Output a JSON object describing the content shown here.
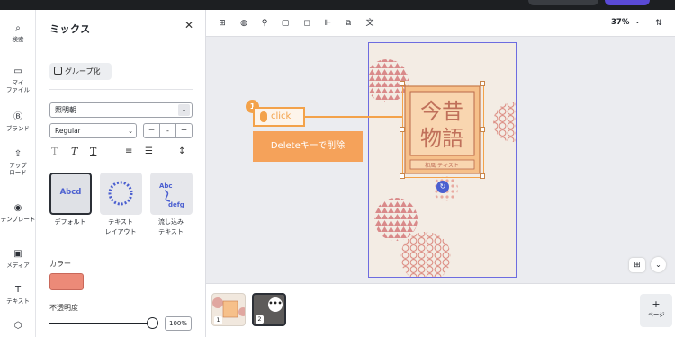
{
  "rail": {
    "items": [
      {
        "label": "検索",
        "icon": "search-icon",
        "glyph": "⌕"
      },
      {
        "label": "マイ\nファイル",
        "icon": "folder-icon",
        "glyph": "▭"
      },
      {
        "label": "ブランド",
        "icon": "brand-icon",
        "glyph": "Ⓑ"
      },
      {
        "label": "アップ\nロード",
        "icon": "upload-icon",
        "glyph": "⇪"
      },
      {
        "label": "テンプレート",
        "icon": "template-icon",
        "glyph": "◉"
      },
      {
        "label": "メディア",
        "icon": "media-icon",
        "glyph": "▣"
      },
      {
        "label": "テキスト",
        "icon": "text-icon",
        "glyph": "T"
      },
      {
        "label": "",
        "icon": "more-icon",
        "glyph": "⬡"
      }
    ]
  },
  "panel": {
    "title": "ミックス",
    "group_button": "グループ化",
    "font": "照明朝",
    "weight": "Regular",
    "size_minus": "−",
    "size_value": "-",
    "size_plus": "+",
    "effects": [
      {
        "label": "デフォルト",
        "preview": "Abcd",
        "selected": true
      },
      {
        "label": "テキスト\nレイアウト",
        "preview": "ABCDEFGHIJK",
        "selected": false
      },
      {
        "label": "流し込み\nテキスト",
        "preview": "Abc defg",
        "selected": false
      }
    ],
    "color_label": "カラー",
    "color_value": "#ec8a78",
    "opacity_label": "不透明度",
    "opacity_value": "100%"
  },
  "toolbar": {
    "zoom": "37%"
  },
  "annotation": {
    "number": "1",
    "click": "click",
    "instruction": "Deleteキーで削除"
  },
  "artwork": {
    "line1": "今昔",
    "line2": "物語",
    "subtitle": "和風 テキスト"
  },
  "pages": {
    "thumbs": [
      "1",
      "2"
    ],
    "more": "•••",
    "add_label": "ページ",
    "add_plus": "+"
  },
  "colors": {
    "accent": "#f3a24a",
    "selection": "#6d6ce0",
    "pattern": "#d98a8a"
  }
}
